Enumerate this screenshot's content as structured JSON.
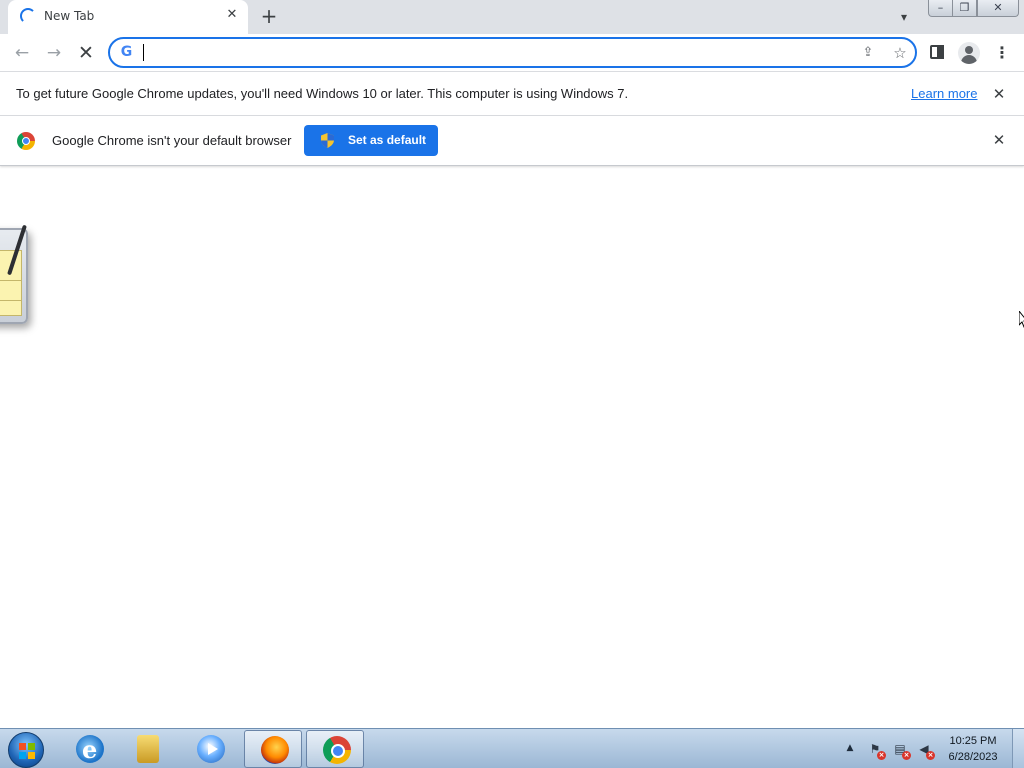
{
  "tab": {
    "title": "New Tab"
  },
  "toolbar": {
    "omnibox_value": "",
    "search_engine_icon": "G"
  },
  "infobar_update": {
    "message": "To get future Google Chrome updates, you'll need Windows 10 or later. This computer is using Windows 7.",
    "link_label": "Learn more"
  },
  "infobar_default": {
    "message": "Google Chrome isn't your default browser",
    "button_label": "Set as default"
  },
  "taskbar": {
    "apps": [
      "internet-explorer",
      "windows-explorer",
      "windows-media-player",
      "firefox",
      "chrome"
    ],
    "clock_time": "10:25 PM",
    "clock_date": "6/28/2023"
  },
  "colors": {
    "accent": "#1a73e8",
    "tabstrip": "#dee1e6",
    "taskbar": "#9bb7d4"
  }
}
